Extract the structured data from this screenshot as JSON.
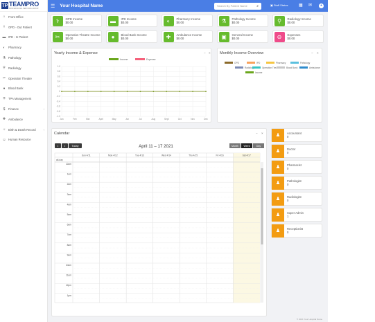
{
  "brand": {
    "logo_mark": "TP",
    "name": "TEAMPRO",
    "tagline": "PROFESSIONAL SERVICES GROUP"
  },
  "sidebar": {
    "items": [
      {
        "label": "Front Office",
        "icon": "home-icon",
        "chev": false
      },
      {
        "label": "OPD - Out Patient",
        "icon": "stethoscope-icon",
        "chev": false
      },
      {
        "label": "IPD - In Patient",
        "icon": "bed-icon",
        "chev": false
      },
      {
        "label": "Pharmacy",
        "icon": "pill-icon",
        "chev": false
      },
      {
        "label": "Pathology",
        "icon": "flask-icon",
        "chev": false
      },
      {
        "label": "Radiology",
        "icon": "microscope-icon",
        "chev": false
      },
      {
        "label": "Operation Theatre",
        "icon": "scissors-icon",
        "chev": false
      },
      {
        "label": "Blood Bank",
        "icon": "droplet-icon",
        "chev": false
      },
      {
        "label": "TPA Management",
        "icon": "umbrella-icon",
        "chev": false
      },
      {
        "label": "Finance",
        "icon": "money-icon",
        "chev": true
      },
      {
        "label": "Ambulance",
        "icon": "ambulance-icon",
        "chev": false
      },
      {
        "label": "Birth & Death Record",
        "icon": "birth-icon",
        "chev": true
      },
      {
        "label": "Human Resource",
        "icon": "users-icon",
        "chev": false
      }
    ]
  },
  "header": {
    "menu_icon": "hamburger-icon",
    "title": "Your Hospital Name",
    "search_placeholder": "Search By Patient Name",
    "staff_label": "Staff Status",
    "icons": [
      "calendar-icon",
      "envelope-icon",
      "user-icon"
    ]
  },
  "income_cards": [
    {
      "label": "OPD Income",
      "value": "$0.00",
      "color": "#66bb2d",
      "icon": "stethoscope-icon"
    },
    {
      "label": "IPD Income",
      "value": "$0.00",
      "color": "#66bb2d",
      "icon": "bed-icon"
    },
    {
      "label": "Pharmacy Income",
      "value": "$0.00",
      "color": "#66bb2d",
      "icon": "pill-icon"
    },
    {
      "label": "Pathology Income",
      "value": "$0.00",
      "color": "#66bb2d",
      "icon": "flask-icon"
    },
    {
      "label": "Radiology Income",
      "value": "$0.00",
      "color": "#66bb2d",
      "icon": "microscope-icon"
    },
    {
      "label": "Operation Theatre Income",
      "value": "$0.00",
      "color": "#66bb2d",
      "icon": "scissors-icon"
    },
    {
      "label": "Blood Bank Income",
      "value": "$0.00",
      "color": "#66bb2d",
      "icon": "droplet-icon"
    },
    {
      "label": "Ambulance Income",
      "value": "$0.00",
      "color": "#66bb2d",
      "icon": "ambulance-icon"
    },
    {
      "label": "General Income",
      "value": "$0.00",
      "color": "#66bb2d",
      "icon": "cash-icon"
    },
    {
      "label": "Expenses",
      "value": "$0.00",
      "color": "#ef4b8a",
      "icon": "minus-icon"
    }
  ],
  "yearly_panel": {
    "title": "Yearly Income & Expense",
    "ctrl_minus": "−",
    "ctrl_close": "×"
  },
  "monthly_panel": {
    "title": "Monthly Income Overview",
    "ctrl_minus": "−",
    "ctrl_close": "×"
  },
  "chart_data": [
    {
      "type": "line",
      "title": "",
      "legend": [
        "Income",
        "Expense"
      ],
      "colors": [
        "#6aa61c",
        "#f5607a"
      ],
      "categories": [
        "Jan",
        "Feb",
        "Mar",
        "April",
        "May",
        "Jun",
        "Jul",
        "Aug",
        "Sept",
        "Oct",
        "Nov",
        "Dec"
      ],
      "series": [
        {
          "name": "Income",
          "values": [
            0,
            0,
            0,
            0,
            0,
            0,
            0,
            0,
            0,
            0,
            0,
            0
          ]
        },
        {
          "name": "Expense",
          "values": [
            0,
            0,
            0,
            0,
            0,
            0,
            0,
            0,
            0,
            0,
            0,
            0
          ]
        }
      ],
      "y_ticks": [
        "1.0",
        "0.8",
        "0.6",
        "0.4",
        "0.2",
        "0",
        "-0.2",
        "-0.4",
        "-0.6",
        "-0.8",
        "-1.0"
      ],
      "ylim": [
        -1,
        1
      ],
      "grid": true,
      "legend_position": "top"
    },
    {
      "type": "pie",
      "title": "",
      "legend": [
        "OPD",
        "IPD",
        "Pharmacy",
        "Pathology",
        "Radiology",
        "Operation Theatre",
        "Blood Bank",
        "Ambulance",
        "Income"
      ],
      "colors": [
        "#8b6a2a",
        "#f7a35c",
        "#f5c542",
        "#5bc0de",
        "#7c8bb5",
        "#36c5c5",
        "#c7c7c7",
        "#2e8bcc",
        "#6aa61c"
      ],
      "values": [
        0,
        0,
        0,
        0,
        0,
        0,
        0,
        0,
        0
      ],
      "legend_position": "top"
    }
  ],
  "calendar": {
    "title": "Calendar",
    "range": "April 11 – 17 2021",
    "today": "Today",
    "prev": "‹",
    "next": "›",
    "views": [
      "Month",
      "Week",
      "Day"
    ],
    "active_view": "Week",
    "days": [
      "Sun 4/11",
      "Mon 4/12",
      "Tue 4/13",
      "Wed 4/14",
      "Thu 4/15",
      "Fri 4/16",
      "Sat 4/17"
    ],
    "highlight_day": 6,
    "allday": "all-day",
    "times": [
      "12am",
      "1am",
      "2am",
      "3am",
      "4am",
      "5am",
      "6am",
      "7am",
      "8am",
      "9am",
      "10am",
      "11am",
      "12pm",
      "1pm"
    ],
    "ctrl_minus": "−",
    "ctrl_close": "×"
  },
  "staff": [
    {
      "label": "Accountant",
      "count": "0",
      "icon": "user-icon"
    },
    {
      "label": "Doctor",
      "count": "0",
      "icon": "user-icon"
    },
    {
      "label": "Pharmacist",
      "count": "0",
      "icon": "user-icon"
    },
    {
      "label": "Pathologist",
      "count": "0",
      "icon": "user-icon"
    },
    {
      "label": "Radiologist",
      "count": "0",
      "icon": "user-icon"
    },
    {
      "label": "Super Admin",
      "count": "1",
      "icon": "user-icon"
    },
    {
      "label": "Receptionist",
      "count": "0",
      "icon": "user-icon"
    }
  ],
  "footer": "© 2021 Your Hospital Name"
}
